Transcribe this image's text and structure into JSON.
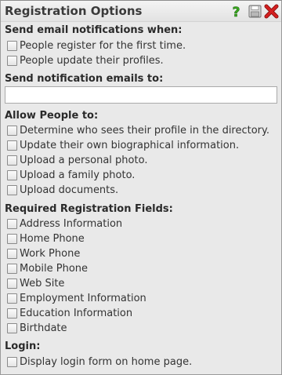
{
  "panel": {
    "title": "Registration Options",
    "icons": [
      "help-icon",
      "save-icon",
      "close-icon"
    ]
  },
  "notifications": {
    "heading": "Send email notifications when:",
    "options": [
      "People register for the first time.",
      "People update their profiles."
    ]
  },
  "emails": {
    "heading": "Send notification emails to:",
    "value": "",
    "placeholder": ""
  },
  "allow": {
    "heading": "Allow People to:",
    "options": [
      "Determine who sees their profile in the directory.",
      "Update their own biographical information.",
      "Upload a personal photo.",
      "Upload a family photo.",
      "Upload documents."
    ]
  },
  "required": {
    "heading": "Required Registration Fields:",
    "options": [
      "Address Information",
      "Home Phone",
      "Work Phone",
      "Mobile Phone",
      "Web Site",
      "Employment Information",
      "Education Information",
      "Birthdate"
    ]
  },
  "login": {
    "heading": "Login:",
    "options": [
      "Display login form on home page."
    ]
  },
  "colors": {
    "help": "#3aa820",
    "close": "#d42020",
    "panel_bg": "#e9e9e9"
  }
}
